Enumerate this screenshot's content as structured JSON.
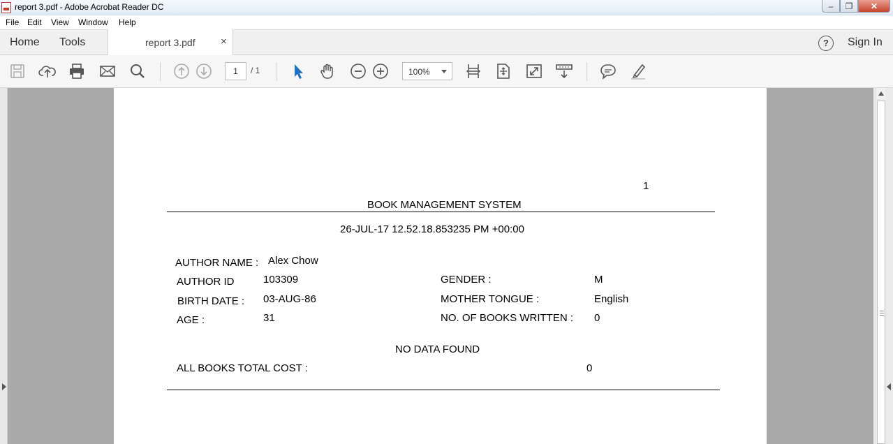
{
  "window": {
    "title": "report 3.pdf - Adobe Acrobat Reader DC",
    "minimize": "–",
    "maximize": "❐",
    "close": "✕"
  },
  "menu": [
    "File",
    "Edit",
    "View",
    "Window",
    "Help"
  ],
  "tabs": {
    "home": "Home",
    "tools": "Tools",
    "document": "report 3.pdf",
    "close_glyph": "×",
    "help_glyph": "?",
    "sign_in": "Sign In"
  },
  "toolbar": {
    "page_current": "1",
    "page_total": "/ 1",
    "zoom": "100%",
    "icons": [
      "save-icon",
      "upload-cloud-icon",
      "print-icon",
      "email-icon",
      "search-icon",
      "previous-page-icon",
      "next-page-icon",
      "select-pointer-icon",
      "hand-tool-icon",
      "zoom-out-icon",
      "zoom-in-icon",
      "fit-width-icon",
      "fit-page-icon",
      "full-screen-icon",
      "read-mode-icon",
      "comment-icon",
      "highlight-pen-icon"
    ],
    "accent": "#1a73c8"
  },
  "report": {
    "page_number": "1",
    "title": "BOOK MANAGEMENT SYSTEM",
    "timestamp": "26-JUL-17 12.52.18.853235 PM +00:00",
    "author_name_label": "AUTHOR NAME :",
    "author_name": "Alex Chow",
    "author_id_label": "AUTHOR ID",
    "author_id": "103309",
    "birth_date_label": "BIRTH DATE :",
    "birth_date": "03-AUG-86",
    "age_label": "AGE :",
    "age": "31",
    "gender_label": "GENDER :",
    "gender": "M",
    "mother_tongue_label": "MOTHER TONGUE :",
    "mother_tongue": "English",
    "books_written_label": "NO. OF BOOKS WRITTEN :",
    "books_written": "0",
    "no_data": "NO DATA FOUND",
    "total_cost_label": "ALL BOOKS TOTAL COST :",
    "total_cost": "0"
  }
}
